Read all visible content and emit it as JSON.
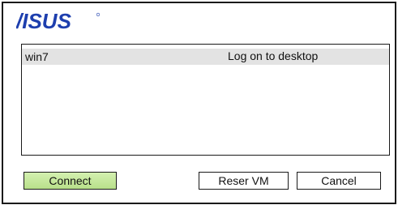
{
  "brand": {
    "logo_text": "/ISUS",
    "logo_color": "#1e3fae"
  },
  "vm_list": {
    "rows": [
      {
        "name": "win7",
        "action": "Log on to desktop"
      }
    ]
  },
  "buttons": {
    "connect": "Connect",
    "reset_vm": "Reser VM",
    "cancel": "Cancel"
  },
  "colors": {
    "row_highlight": "#e3e3e3",
    "connect_button": "#c6e89c"
  }
}
